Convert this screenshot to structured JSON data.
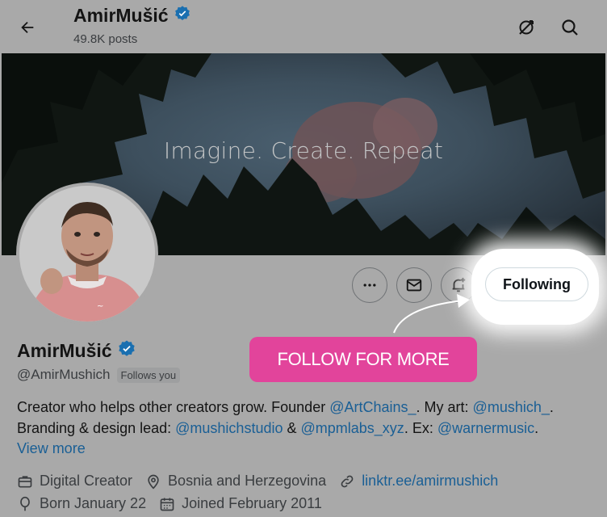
{
  "topbar": {
    "name": "AmirMušić",
    "posts": "49.8K posts"
  },
  "banner": {
    "tagline": "Imagine. Create. Repeat"
  },
  "actions": {
    "following_label": "Following"
  },
  "promo": {
    "label": "FOLLOW FOR MORE"
  },
  "profile": {
    "name": "AmirMušić",
    "handle": "@AmirMushich",
    "follows_you": "Follows you",
    "bio": {
      "t1": "Creator who helps other creators grow. Founder ",
      "l1": "@ArtChains_",
      "t2": ". My art: ",
      "l2": "@mushich_",
      "t3": ". Branding & design lead: ",
      "l3": "@mushichstudio",
      "t4": " & ",
      "l4": "@mpmlabs_xyz",
      "t5": ". Ex: ",
      "l5": "@warnermusic",
      "t6": "."
    },
    "view_more": "View more",
    "category": "Digital Creator",
    "location": "Bosnia and Herzegovina",
    "website": "linktr.ee/amirmushich",
    "born": "Born January 22",
    "joined": "Joined February 2011"
  },
  "colors": {
    "accent_link": "#1a5f95",
    "verified": "#1d9bf0",
    "promo": "#e2449b",
    "dim_overlay": "#a9a9a9"
  }
}
